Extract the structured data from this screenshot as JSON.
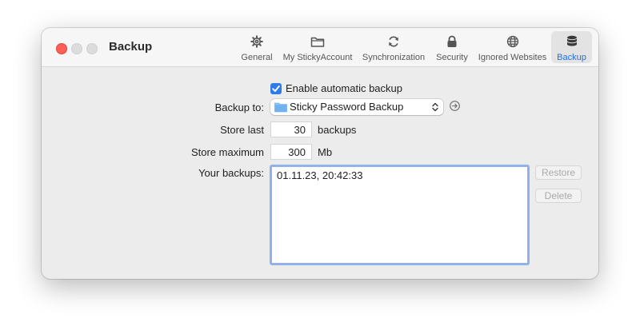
{
  "window": {
    "title": "Backup",
    "tabs": [
      {
        "label": "General",
        "icon": "gear-icon"
      },
      {
        "label": "My StickyAccount",
        "icon": "folder-icon"
      },
      {
        "label": "Synchronization",
        "icon": "sync-icon"
      },
      {
        "label": "Security",
        "icon": "lock-icon"
      },
      {
        "label": "Ignored Websites",
        "icon": "globe-icon"
      },
      {
        "label": "Backup",
        "icon": "database-icon",
        "active": true
      }
    ]
  },
  "form": {
    "enable_backup_label": "Enable automatic backup",
    "enable_backup_checked": true,
    "backup_to_label": "Backup to:",
    "backup_to_value": "Sticky Password Backup",
    "store_last_label": "Store last",
    "store_last_value": "30",
    "store_last_unit": "backups",
    "store_max_label": "Store maximum",
    "store_max_value": "300",
    "store_max_unit": "Mb",
    "your_backups_label": "Your backups:",
    "backups": [
      "01.11.23, 20:42:33"
    ],
    "restore_button": "Restore",
    "delete_button": "Delete"
  },
  "colors": {
    "accent": "#2f7ce9",
    "active_tab_text": "#1f6fe0",
    "close_button": "#fe5f57",
    "list_focus_ring": "#8fb2ea"
  }
}
